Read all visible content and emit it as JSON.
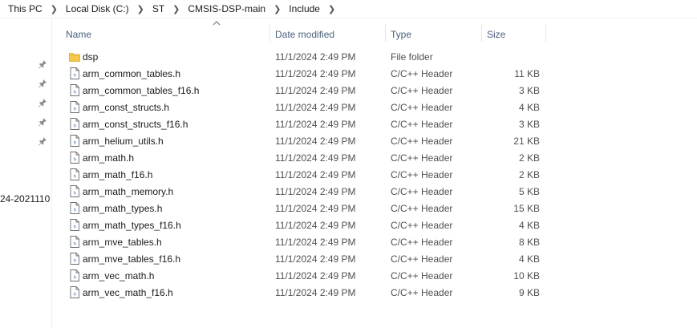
{
  "breadcrumb": [
    "This PC",
    "Local Disk (C:)",
    "ST",
    "CMSIS-DSP-main",
    "Include"
  ],
  "nav": {
    "truncated_item": "24-2021110"
  },
  "columns": {
    "name": "Name",
    "date": "Date modified",
    "type": "Type",
    "size": "Size"
  },
  "files": [
    {
      "name": "dsp",
      "date": "11/1/2024 2:49 PM",
      "type": "File folder",
      "size": "",
      "icon": "folder-icon"
    },
    {
      "name": "arm_common_tables.h",
      "date": "11/1/2024 2:49 PM",
      "type": "C/C++ Header",
      "size": "11 KB",
      "icon": "header-file-icon"
    },
    {
      "name": "arm_common_tables_f16.h",
      "date": "11/1/2024 2:49 PM",
      "type": "C/C++ Header",
      "size": "3 KB",
      "icon": "header-file-icon"
    },
    {
      "name": "arm_const_structs.h",
      "date": "11/1/2024 2:49 PM",
      "type": "C/C++ Header",
      "size": "4 KB",
      "icon": "header-file-icon"
    },
    {
      "name": "arm_const_structs_f16.h",
      "date": "11/1/2024 2:49 PM",
      "type": "C/C++ Header",
      "size": "3 KB",
      "icon": "header-file-icon"
    },
    {
      "name": "arm_helium_utils.h",
      "date": "11/1/2024 2:49 PM",
      "type": "C/C++ Header",
      "size": "21 KB",
      "icon": "header-file-icon"
    },
    {
      "name": "arm_math.h",
      "date": "11/1/2024 2:49 PM",
      "type": "C/C++ Header",
      "size": "2 KB",
      "icon": "header-file-icon"
    },
    {
      "name": "arm_math_f16.h",
      "date": "11/1/2024 2:49 PM",
      "type": "C/C++ Header",
      "size": "2 KB",
      "icon": "header-file-icon"
    },
    {
      "name": "arm_math_memory.h",
      "date": "11/1/2024 2:49 PM",
      "type": "C/C++ Header",
      "size": "5 KB",
      "icon": "header-file-icon"
    },
    {
      "name": "arm_math_types.h",
      "date": "11/1/2024 2:49 PM",
      "type": "C/C++ Header",
      "size": "15 KB",
      "icon": "header-file-icon"
    },
    {
      "name": "arm_math_types_f16.h",
      "date": "11/1/2024 2:49 PM",
      "type": "C/C++ Header",
      "size": "4 KB",
      "icon": "header-file-icon"
    },
    {
      "name": "arm_mve_tables.h",
      "date": "11/1/2024 2:49 PM",
      "type": "C/C++ Header",
      "size": "8 KB",
      "icon": "header-file-icon"
    },
    {
      "name": "arm_mve_tables_f16.h",
      "date": "11/1/2024 2:49 PM",
      "type": "C/C++ Header",
      "size": "4 KB",
      "icon": "header-file-icon"
    },
    {
      "name": "arm_vec_math.h",
      "date": "11/1/2024 2:49 PM",
      "type": "C/C++ Header",
      "size": "10 KB",
      "icon": "header-file-icon"
    },
    {
      "name": "arm_vec_math_f16.h",
      "date": "11/1/2024 2:49 PM",
      "type": "C/C++ Header",
      "size": "9 KB",
      "icon": "header-file-icon"
    }
  ],
  "colors": {
    "header_text": "#4c607a",
    "folder": "#f5c84c",
    "pin": "#8a8a8a"
  }
}
